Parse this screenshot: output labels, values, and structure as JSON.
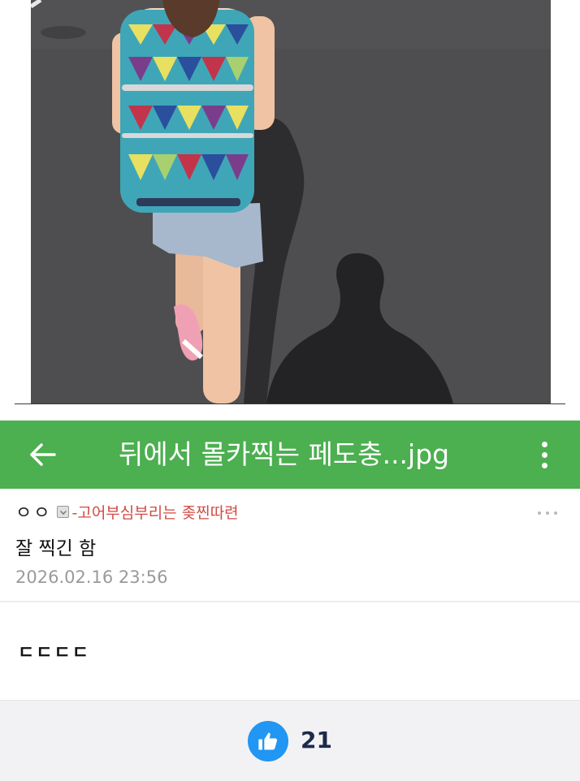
{
  "header": {
    "title": "뒤에서 몰카찍는 페도충...jpg",
    "bar_color": "#4caf50"
  },
  "comment": {
    "author_name": "ㅇㅇ",
    "author_tag": "-고어부심부리는 좆찐따련",
    "text": "잘 찍긴 함",
    "date": "2026.02.16 23:56"
  },
  "reply": {
    "text": "ㄷㄷㄷㄷ"
  },
  "footer": {
    "like_count": "21",
    "like_color": "#2196f3"
  },
  "icons": {
    "back": "arrow-left-icon",
    "more": "vertical-dots-icon",
    "comment_more": "horizontal-dots-icon",
    "like": "thumbs-up-icon",
    "author_badge": "badge-icon"
  }
}
